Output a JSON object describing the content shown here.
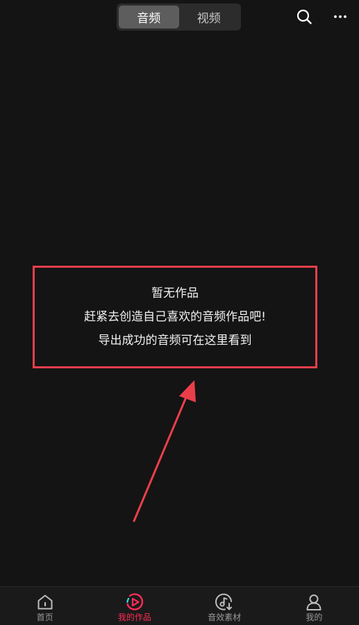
{
  "header": {
    "tabs": [
      {
        "label": "音频",
        "active": true
      },
      {
        "label": "视频",
        "active": false
      }
    ],
    "search_icon": "search-icon",
    "more_icon": "more-horizontal-icon"
  },
  "empty_state": {
    "title": "暂无作品",
    "line2": "赶紧去创造自己喜欢的音频作品吧!",
    "line3": "导出成功的音频可在这里看到"
  },
  "colors": {
    "background": "#141414",
    "annotation": "#ea3f4b",
    "accent": "#fe2c55"
  },
  "bottom_nav": {
    "items": [
      {
        "label": "首页",
        "icon": "home-icon",
        "active": false
      },
      {
        "label": "我的作品",
        "icon": "play-circle-icon",
        "active": true
      },
      {
        "label": "音效素材",
        "icon": "music-download-icon",
        "active": false
      },
      {
        "label": "我的",
        "icon": "person-icon",
        "active": false
      }
    ]
  }
}
